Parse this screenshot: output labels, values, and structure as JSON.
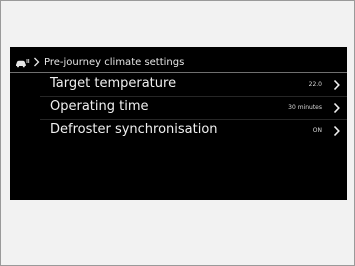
{
  "header": {
    "breadcrumb_icon": "car-climate-icon",
    "separator_icon": "chevron-right-icon",
    "title": "Pre-journey climate settings"
  },
  "settings": [
    {
      "label": "Target temperature",
      "value": "22.0",
      "icon": "chevron-right-icon"
    },
    {
      "label": "Operating time",
      "value": "30 minutes",
      "icon": "chevron-right-icon"
    },
    {
      "label": "Defroster synchronisation",
      "value": "ON",
      "icon": "chevron-right-icon"
    }
  ],
  "colors": {
    "screen_background": "#000000",
    "page_background": "#f2f2f2",
    "text": "#f0f0f0"
  }
}
